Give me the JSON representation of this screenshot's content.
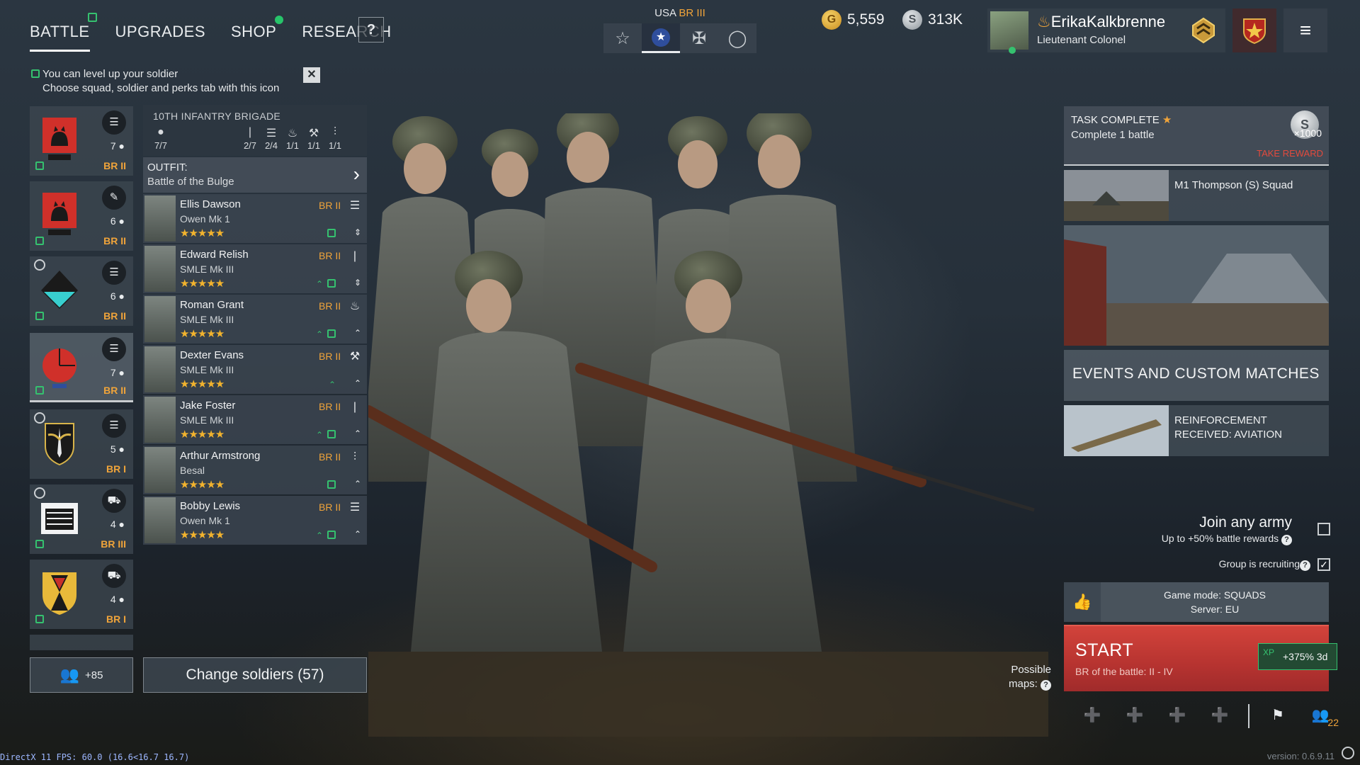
{
  "nav": {
    "tabs": [
      {
        "label": "BATTLE"
      },
      {
        "label": "UPGRADES"
      },
      {
        "label": "SHOP"
      },
      {
        "label": "RESEARCH"
      }
    ],
    "help_label": "?"
  },
  "hint": {
    "line1": "You can level up your soldier",
    "line2": "Choose squad, soldier and perks tab with this icon",
    "close_label": "✕"
  },
  "nation": {
    "country": "USA",
    "br": "BR III"
  },
  "currency": {
    "gold": "5,559",
    "silver": "313K"
  },
  "profile": {
    "name": "ErikaKalkbrenne",
    "rank": "Lieutenant Colonel"
  },
  "squads": [
    {
      "count": "7",
      "br": "BR II",
      "type_icon": "list-icon"
    },
    {
      "count": "6",
      "br": "BR II",
      "type_icon": "feather-icon"
    },
    {
      "count": "6",
      "br": "BR II",
      "type_icon": "list-icon"
    },
    {
      "count": "7",
      "br": "BR II",
      "type_icon": "list-icon"
    },
    {
      "count": "5",
      "br": "BR I",
      "type_icon": "list-icon"
    },
    {
      "count": "4",
      "br": "BR III",
      "type_icon": "vehicle-icon"
    },
    {
      "count": "4",
      "br": "BR I",
      "type_icon": "tank-icon"
    }
  ],
  "squad_panel": {
    "brigade_name": "10TH INFANTRY BRIGADE",
    "stats": [
      "7/7",
      "2/7",
      "2/4",
      "1/1",
      "1/1",
      "1/1"
    ],
    "outfit_label": "OUTFIT:",
    "outfit_value": "Battle of the Bulge"
  },
  "soldiers": [
    {
      "name": "Ellis Dawson",
      "weapon": "Owen Mk 1",
      "br": "BR II",
      "stars": "★★★★★"
    },
    {
      "name": "Edward Relish",
      "weapon": "SMLE Mk III",
      "br": "BR II",
      "stars": "★★★★★"
    },
    {
      "name": "Roman Grant",
      "weapon": "SMLE Mk III",
      "br": "BR II",
      "stars": "★★★★★"
    },
    {
      "name": "Dexter Evans",
      "weapon": "SMLE Mk III",
      "br": "BR II",
      "stars": "★★★★★"
    },
    {
      "name": "Jake Foster",
      "weapon": "SMLE Mk III",
      "br": "BR II",
      "stars": "★★★★★"
    },
    {
      "name": "Arthur Armstrong",
      "weapon": "Besal",
      "br": "BR II",
      "stars": "★★★★★"
    },
    {
      "name": "Bobby Lewis",
      "weapon": "Owen Mk 1",
      "br": "BR II",
      "stars": "★★★★★"
    }
  ],
  "reserve": {
    "count": "+85"
  },
  "change_soldiers_label": "Change soldiers (57)",
  "task": {
    "title": "TASK COMPLETE",
    "desc": "Complete 1 battle",
    "reward_amount": "×1000",
    "reward_label": "TAKE REWARD"
  },
  "cards": {
    "squad_offer": "M1 Thompson (S) Squad",
    "events_label": "EVENTS AND CUSTOM MATCHES",
    "reinforcement": "REINFORCEMENT RECEIVED: AVIATION"
  },
  "join": {
    "title": "Join any army",
    "subtitle": "Up to +50% battle rewards",
    "recruiting": "Group is recruiting"
  },
  "game": {
    "mode": "Game mode: SQUADS",
    "server": "Server: EU"
  },
  "start": {
    "label": "START",
    "sub": "BR of the battle: II - IV",
    "xp_label": "XP",
    "xp": "+375% 3d"
  },
  "maps": {
    "line1": "Possible",
    "line2": "maps:"
  },
  "group": {
    "count": "22"
  },
  "footer": {
    "fps": "DirectX 11 FPS: 60.0 (16.6<16.7 16.7)",
    "version": "version: 0.6.9.11"
  },
  "colors": {
    "br_orange": "#f0a43a",
    "level_green": "#35c16f",
    "start_red": "#c03a36",
    "star_gold": "#f2b32e"
  }
}
